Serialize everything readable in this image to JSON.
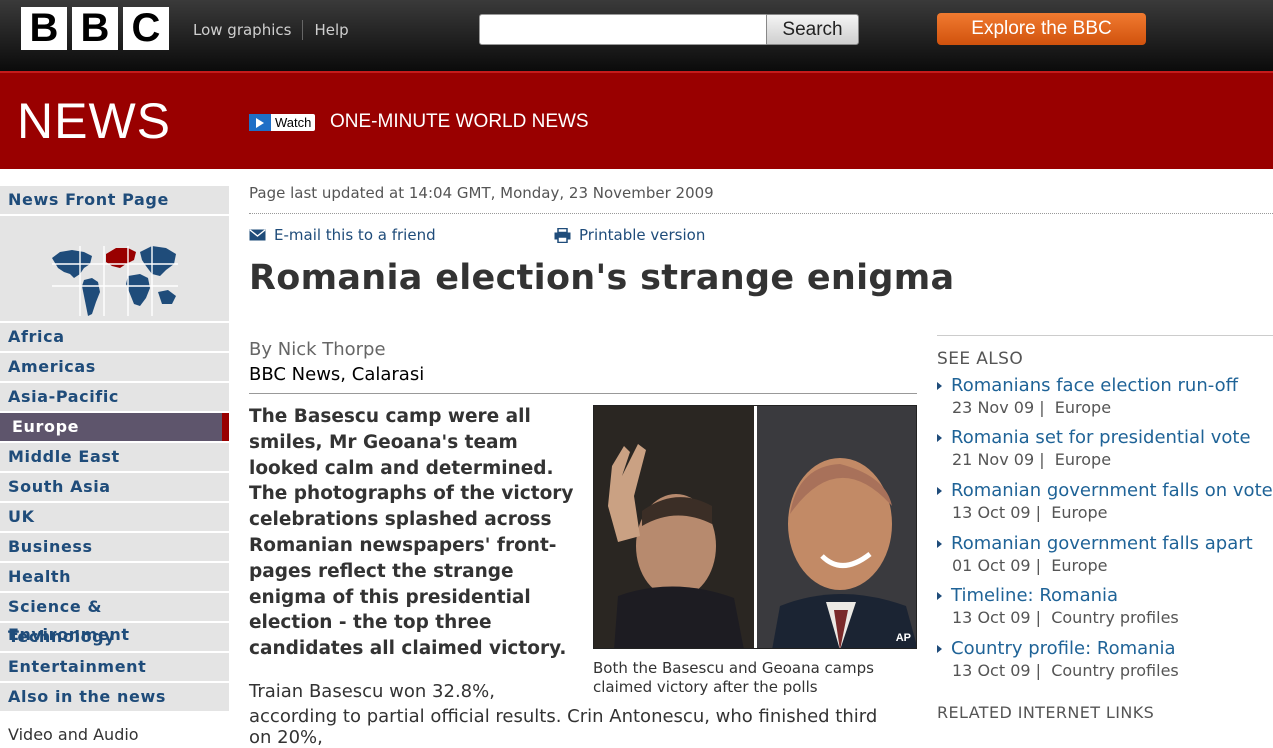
{
  "header": {
    "logo_letters": [
      "B",
      "B",
      "C"
    ],
    "links": [
      "Low graphics",
      "Help"
    ],
    "search": {
      "placeholder": "",
      "button_label": "Search"
    },
    "explore_label": "Explore the BBC"
  },
  "banner": {
    "section_title": "NEWS",
    "watch_badge": "Watch",
    "watch_title": "ONE-MINUTE WORLD NEWS"
  },
  "nav": {
    "front_page": "News Front Page",
    "items": [
      "Africa",
      "Americas",
      "Asia-Pacific",
      "Europe",
      "Middle East",
      "South Asia",
      "UK",
      "Business",
      "Health",
      "Science & Environment",
      "Technology",
      "Entertainment",
      "Also in the news"
    ],
    "active": "Europe",
    "video_label": "Video and Audio"
  },
  "article": {
    "updated": "Page last updated at 14:04 GMT, Monday, 23 November 2009",
    "email_link": "E-mail this to a friend",
    "print_link": "Printable version",
    "headline": "Romania election's strange enigma",
    "author": "By Nick Thorpe",
    "location": "BBC News, Calarasi",
    "intro": "The Basescu camp were all smiles, Mr Geoana's team looked calm and determined. The photographs of the victory celebrations splashed across Romanian newspapers' front-pages reflect the strange enigma of this presidential election - the top three candidates all claimed victory.",
    "body_first": "Traian Basescu won 32.8%,",
    "body_second": "according to partial official results. Crin Antonescu, who finished third on 20%,",
    "photo_credit": "AP",
    "photo_caption": "Both the Basescu and Geoana camps claimed victory after the polls"
  },
  "see_also": {
    "title": "SEE ALSO",
    "items": [
      {
        "title": "Romanians face election run-off",
        "date": "23 Nov 09",
        "section": "Europe"
      },
      {
        "title": "Romania set for presidential vote",
        "date": "21 Nov 09",
        "section": "Europe"
      },
      {
        "title": "Romanian government falls on vote",
        "date": "13 Oct 09",
        "section": "Europe"
      },
      {
        "title": "Romanian government falls apart",
        "date": "01 Oct 09",
        "section": "Europe"
      },
      {
        "title": "Timeline: Romania",
        "date": "13 Oct 09",
        "section": "Country profiles"
      },
      {
        "title": "Country profile: Romania",
        "date": "13 Oct 09",
        "section": "Country profiles"
      }
    ],
    "related_title": "RELATED INTERNET LINKS"
  },
  "colors": {
    "brand_red": "#990000",
    "explore_orange": "#e4631b",
    "nav_active": "#5e556c",
    "link_blue": "#1f6397"
  },
  "icons": {
    "email": "envelope-icon",
    "print": "printer-icon",
    "watch": "play-icon",
    "see_also_bullet": "triangle-bullet-icon"
  }
}
